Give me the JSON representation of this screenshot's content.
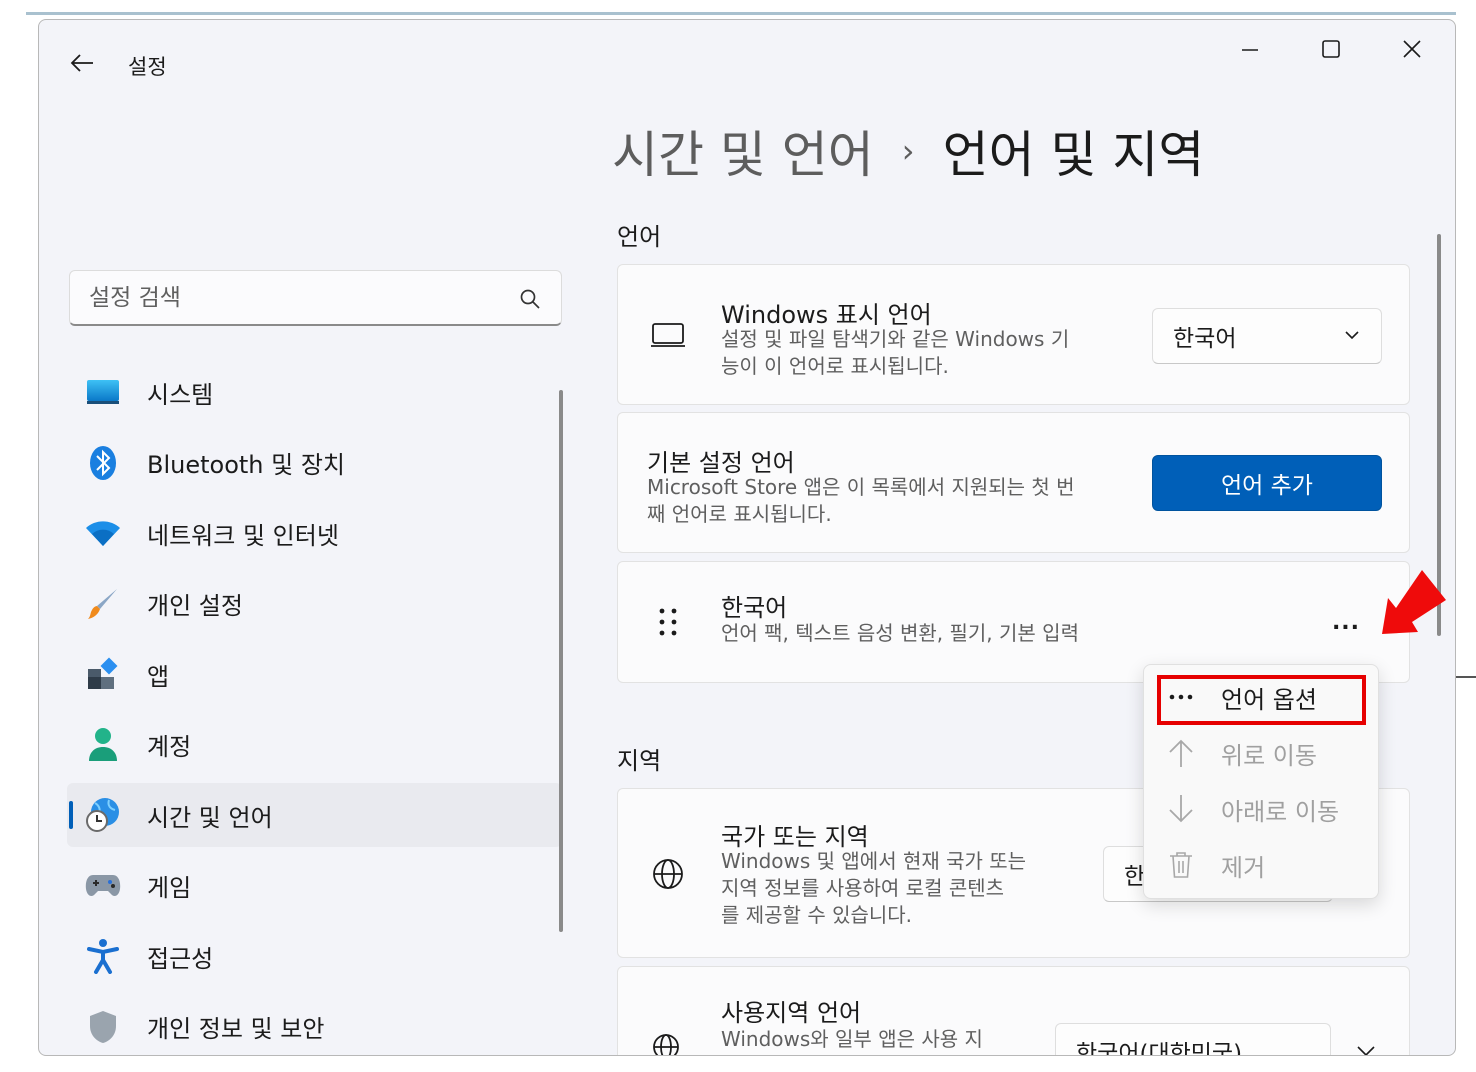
{
  "window": {
    "title": "설정"
  },
  "search": {
    "placeholder": "설정 검색"
  },
  "nav": {
    "items": [
      {
        "label": "시스템"
      },
      {
        "label": "Bluetooth 및 장치"
      },
      {
        "label": "네트워크 및 인터넷"
      },
      {
        "label": "개인 설정"
      },
      {
        "label": "앱"
      },
      {
        "label": "계정"
      },
      {
        "label": "시간 및 언어"
      },
      {
        "label": "게임"
      },
      {
        "label": "접근성"
      },
      {
        "label": "개인 정보 및 보안"
      }
    ],
    "selected": "시간 및 언어"
  },
  "breadcrumb": {
    "parent": "시간 및 언어",
    "separator": "›",
    "current": "언어 및 지역"
  },
  "language_section": {
    "title": "언어",
    "display_language": {
      "title": "Windows 표시 언어",
      "desc_line1": "설정 및 파일 탐색기와 같은 Windows 기",
      "desc_line2": "능이 이 언어로 표시됩니다.",
      "value": "한국어"
    },
    "preferred": {
      "title": "기본 설정 언어",
      "desc_line1": "Microsoft Store 앱은 이 목록에서 지원되는 첫 번",
      "desc_line2": "째 언어로 표시됩니다.",
      "button": "언어 추가"
    },
    "korean": {
      "title": "한국어",
      "desc": "언어 팩, 텍스트 음성 변환, 필기, 기본 입력",
      "more": "..."
    }
  },
  "context_menu": {
    "items": [
      {
        "label": "언어 옵션",
        "enabled": true
      },
      {
        "label": "위로 이동",
        "enabled": false
      },
      {
        "label": "아래로 이동",
        "enabled": false
      },
      {
        "label": "제거",
        "enabled": false
      }
    ]
  },
  "region_section": {
    "title": "지역",
    "country": {
      "title": "국가 또는 지역",
      "desc_line1": "Windows 및 앱에서 현재 국가 또는",
      "desc_line2": "지역 정보를 사용하여 로컬 콘텐츠",
      "desc_line3": "를 제공할 수 있습니다.",
      "value_partial": "한"
    },
    "regional_format": {
      "title": "사용지역 언어",
      "desc_line1": "Windows와 일부 앱은 사용 지",
      "value": "한국어(대한민국)"
    }
  },
  "colors": {
    "accent": "#005fb8",
    "highlight": "#e60000"
  }
}
